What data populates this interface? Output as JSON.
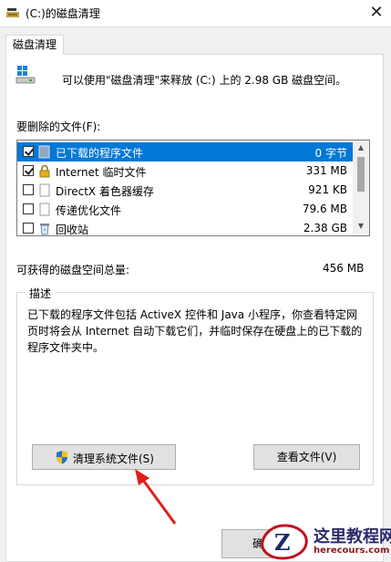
{
  "window": {
    "title": "(C:)的磁盘清理",
    "close_glyph": "✕"
  },
  "tabs": [
    {
      "label": "磁盘清理"
    }
  ],
  "info": {
    "text": "可以使用\"磁盘清理\"来释放 (C:) 上的 2.98 GB 磁盘空间。"
  },
  "files": {
    "label": "要删除的文件(F):",
    "items": [
      {
        "name": "已下载的程序文件",
        "size": "0 字节",
        "checked": true,
        "selected": true,
        "icon": "folder-icon"
      },
      {
        "name": "Internet 临时文件",
        "size": "331 MB",
        "checked": true,
        "selected": false,
        "icon": "lock-icon"
      },
      {
        "name": "DirectX 着色器缓存",
        "size": "921 KB",
        "checked": false,
        "selected": false,
        "icon": "blank-file-icon"
      },
      {
        "name": "传递优化文件",
        "size": "79.6 MB",
        "checked": false,
        "selected": false,
        "icon": "blank-file-icon"
      },
      {
        "name": "回收站",
        "size": "2.38 GB",
        "checked": false,
        "selected": false,
        "icon": "recycle-bin-icon"
      }
    ]
  },
  "total": {
    "label": "可获得的磁盘空间总量:",
    "value": "456 MB"
  },
  "description": {
    "title": "描述",
    "text": "已下载的程序文件包括 ActiveX 控件和 Java 小程序，你查看特定网页时将会从 Internet 自动下载它们，并临时保存在硬盘上的已下载的程序文件夹中。"
  },
  "buttons": {
    "clean_system": "清理系统文件(S)",
    "view_files": "查看文件(V)",
    "ok": "确"
  },
  "watermark": {
    "title": "这里教程网",
    "url": "herecours.com",
    "letter": "Z"
  },
  "colors": {
    "selection": "#0078d7",
    "arrow": "#e0201b"
  }
}
